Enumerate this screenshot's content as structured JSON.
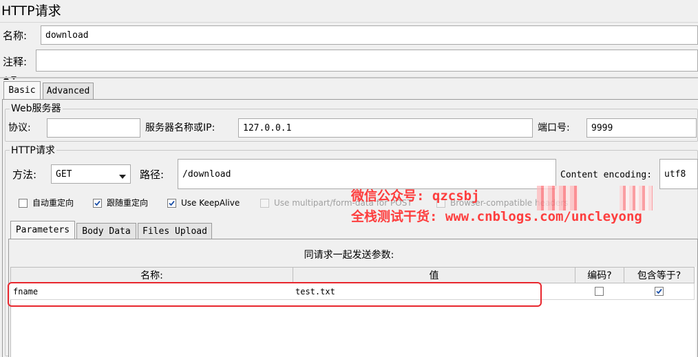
{
  "window": {
    "title": "HTTP请求"
  },
  "form": {
    "name_label": "名称:",
    "name_value": "download",
    "comment_label": "注释:",
    "comment_value": ""
  },
  "tabs": [
    {
      "label": "Basic",
      "active": true
    },
    {
      "label": "Advanced",
      "active": false
    }
  ],
  "web_server": {
    "title": "Web服务器",
    "protocol_label": "协议:",
    "protocol_value": "",
    "server_label": "服务器名称或IP:",
    "server_value": "127.0.0.1",
    "port_label": "端口号:",
    "port_value": "9999"
  },
  "http_request": {
    "title": "HTTP请求",
    "method_label": "方法:",
    "method_value": "GET",
    "path_label": "路径:",
    "path_value": "/download",
    "encoding_label": "Content encoding:",
    "encoding_value": "utf8"
  },
  "options": [
    {
      "label": "自动重定向",
      "checked": false,
      "disabled": false
    },
    {
      "label": "跟随重定向",
      "checked": true,
      "disabled": false
    },
    {
      "label": "Use KeepAlive",
      "checked": true,
      "disabled": false
    },
    {
      "label": "Use multipart/form-data for POST",
      "checked": false,
      "disabled": true
    },
    {
      "label": "Browser-compatible headers",
      "checked": false,
      "disabled": true
    }
  ],
  "sub_tabs": [
    {
      "label": "Parameters",
      "active": true
    },
    {
      "label": "Body Data",
      "active": false
    },
    {
      "label": "Files Upload",
      "active": false
    }
  ],
  "params_table": {
    "caption": "同请求一起发送参数:",
    "headers": [
      "名称:",
      "值",
      "编码?",
      "包含等于?"
    ],
    "rows": [
      {
        "name": "fname",
        "value": "test.txt",
        "encode": false,
        "include_equals": true
      }
    ]
  },
  "watermark": {
    "line1": "微信公众号: qzcsbj",
    "line2": "全栈测试干货: www.cnblogs.com/uncleyong"
  },
  "colors": {
    "highlight": "#e8262d",
    "watermark": "#ff2f2f"
  }
}
